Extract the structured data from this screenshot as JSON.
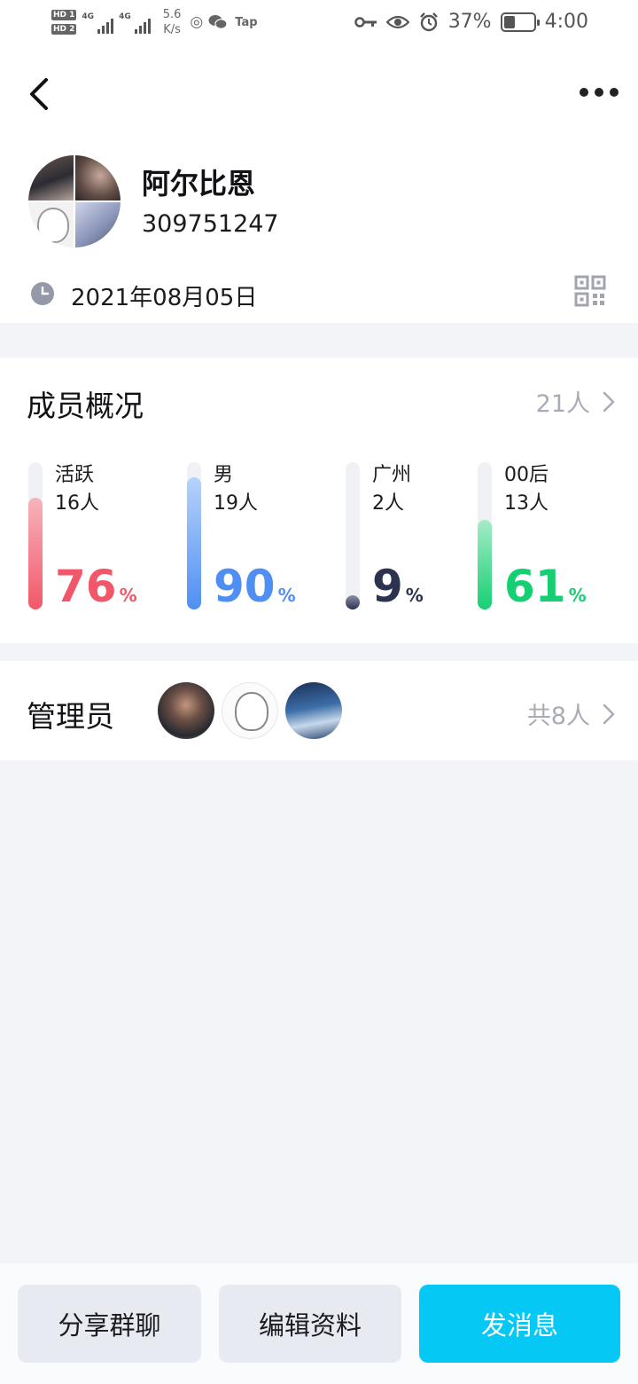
{
  "status_bar": {
    "hd1": "HD 1",
    "hd2": "HD 2",
    "net1": "4G",
    "net2": "4G",
    "speed_value": "5.6",
    "speed_unit": "K/s",
    "tap_label": "Tap",
    "battery_percent": "37%",
    "battery_level": 0.37,
    "time": "4:00",
    "icons": [
      "key-icon",
      "eye-icon",
      "alarm-icon",
      "wechat-icon",
      "target-icon"
    ]
  },
  "group": {
    "name": "阿尔比恩",
    "id": "309751247",
    "created_date": "2021年08月05日"
  },
  "members_overview": {
    "title": "成员概况",
    "total": "21人",
    "stats": [
      {
        "label": "活跃",
        "count": "16人",
        "percent": "76",
        "unit": "%",
        "value": 0.76,
        "color": "#f25769",
        "gradient_top": "#f7b4bc"
      },
      {
        "label": "男",
        "count": "19人",
        "percent": "90",
        "unit": "%",
        "value": 0.9,
        "color": "#4f8ff3",
        "gradient_top": "#b7d2fb"
      },
      {
        "label": "广州",
        "count": "2人",
        "percent": "9",
        "unit": "%",
        "value": 0.09,
        "color": "#2c3350",
        "gradient_top": "#8b90a6"
      },
      {
        "label": "00后",
        "count": "13人",
        "percent": "61",
        "unit": "%",
        "value": 0.61,
        "color": "#16cf73",
        "gradient_top": "#a4ecc6"
      }
    ]
  },
  "admins": {
    "title": "管理员",
    "total": "共8人"
  },
  "bottom_actions": {
    "share": "分享群聊",
    "edit": "编辑资料",
    "send": "发消息",
    "send_color": "#05c8f5"
  }
}
